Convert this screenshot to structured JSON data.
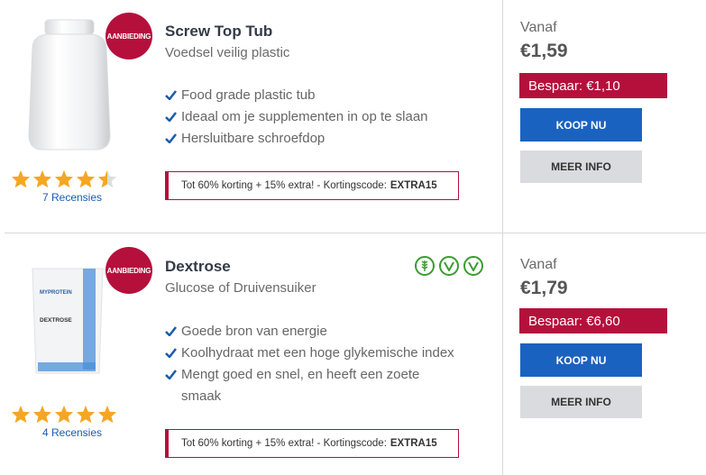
{
  "products": [
    {
      "badge": "AANBIEDING",
      "title": "Screw Top Tub",
      "subtitle": "Voedsel veilig plastic",
      "features": [
        "Food grade plastic tub",
        "Ideaal om je supplementen in op te slaan",
        "Hersluitbare schroefdop"
      ],
      "promo_text": "Tot 60% korting + 15% extra! - Kortingscode:",
      "promo_code": "EXTRA15",
      "rating": 4.5,
      "reviews": "7 Recensies",
      "vanaf": "Vanaf",
      "price": "€1,59",
      "save": "Bespaar: €1,10",
      "buy_label": "KOOP NU",
      "info_label": "MEER INFO"
    },
    {
      "badge": "AANBIEDING",
      "title": "Dextrose",
      "subtitle": "Glucose of Druivensuiker",
      "features": [
        "Goede bron van energie",
        "Koolhydraat met een hoge glykemische index",
        "Mengt goed en snel, en heeft een zoete smaak"
      ],
      "promo_text": "Tot 60% korting + 15% extra! - Kortingscode:",
      "promo_code": "EXTRA15",
      "rating": 5,
      "reviews": "4 Recensies",
      "vanaf": "Vanaf",
      "price": "€1,79",
      "save": "Bespaar: €6,60",
      "buy_label": "KOOP NU",
      "info_label": "MEER INFO",
      "diet_icons": [
        "gluten-free-icon",
        "vegetarian-icon",
        "vegan-icon"
      ],
      "pack_brand": "MYPROTEIN",
      "pack_label": "DEXTROSE"
    }
  ],
  "colors": {
    "accent_red": "#b5103c",
    "button_blue": "#1a62c0",
    "check_blue": "#1a5cb0",
    "star": "#f5a623"
  }
}
